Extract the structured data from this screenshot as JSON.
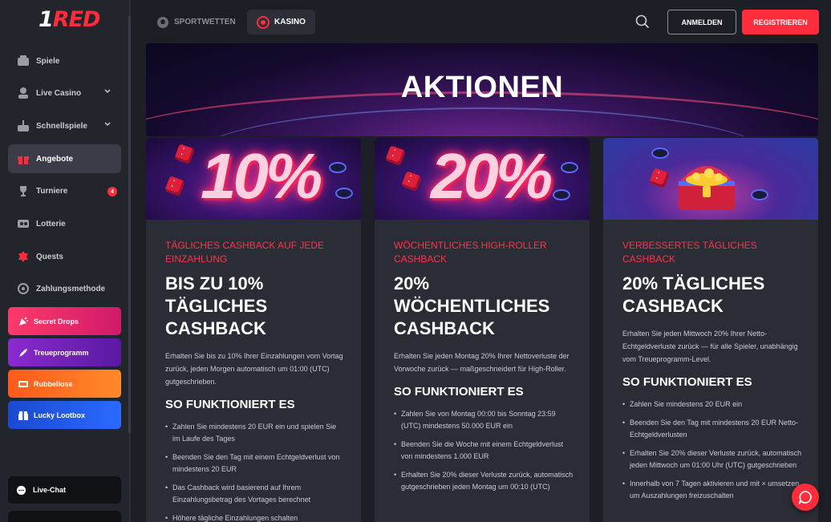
{
  "brand": {
    "logo_prefix": "1",
    "logo_suffix": "RED"
  },
  "sidebar": {
    "items": [
      {
        "label": "Spiele",
        "icon": "games-icon"
      },
      {
        "label": "Live Casino",
        "icon": "live-casino-icon"
      },
      {
        "label": "Schnellspiele",
        "icon": "quick-games-icon"
      },
      {
        "label": "Angebote",
        "icon": "gift-icon"
      },
      {
        "label": "Turniere",
        "icon": "trophy-icon",
        "badge": "4"
      },
      {
        "label": "Lotterie",
        "icon": "lottery-icon"
      },
      {
        "label": "Quests",
        "icon": "quests-icon"
      },
      {
        "label": "Zahlungsmethode",
        "icon": "payment-icon"
      }
    ],
    "promos": [
      {
        "label": "Secret Drops",
        "icon": "confetti-icon"
      },
      {
        "label": "Treueprogramm",
        "icon": "rocket-icon"
      },
      {
        "label": "Rubbellose",
        "icon": "scratch-card-icon"
      },
      {
        "label": "Lucky Lootbox",
        "icon": "lootbox-icon"
      }
    ],
    "chat_label": "Live-Chat"
  },
  "topbar": {
    "tab_sport": "SPORTWETTEN",
    "tab_kasino": "KASINO",
    "login": "ANMELDEN",
    "register": "REGISTRIEREN"
  },
  "hero": {
    "title": "AKTIONEN"
  },
  "cards": [
    {
      "image_text": "10%",
      "subtitle": "TÄGLICHES CASHBACK AUF JEDE EINZAHLUNG",
      "heading": "BIS ZU 10% TÄGLICHES CASHBACK",
      "description": "Erhalten Sie bis zu 10% Ihrer Einzahlungen vom Vortag zurück, jeden Morgen automatisch um 01:00 (UTC) gutgeschrieben.",
      "how_title": "SO FUNKTIONIERT ES",
      "steps": [
        "Zahlen Sie mindestens 20 EUR ein und spielen Sie im Laufe des Tages",
        "Beenden Sie den Tag mit einem Echtgeldverlust von mindestens 20 EUR",
        "Das Cashback wird basierend auf Ihrem Einzahlungsbetrag des Vortages berechnet",
        "Höhere tägliche Einzahlungen schalten"
      ]
    },
    {
      "image_text": "20%",
      "subtitle": "WÖCHENTLICHES HIGH-ROLLER CASHBACK",
      "heading": "20% WÖCHENTLICHES CASHBACK",
      "description": "Erhalten Sie jeden Montag 20% Ihrer Nettoverluste der Vorwoche zurück — maßgeschneidert für High-Roller.",
      "how_title": "SO FUNKTIONIERT ES",
      "steps": [
        "Zahlen Sie von Montag 00:00 bis Sonntag 23:59 (UTC) mindestens 50.000 EUR ein",
        "Beenden Sie die Woche mit einem Echtgeldverlust von mindestens 1.000 EUR",
        "Erhalten Sie 20% dieser Verluste zurück, automatisch gutgeschrieben jeden Montag um 00:10 (UTC)"
      ]
    },
    {
      "image_text": "",
      "subtitle": "VERBESSERTES TÄGLICHES CASHBACK",
      "heading": "20% TÄGLICHES CASHBACK",
      "description": "Erhalten Sie jeden Mittwoch 20% Ihrer Netto-Echtgeldverluste zurück — für alle Spieler, unabhängig vom Treueprogramm-Level.",
      "how_title": "SO FUNKTIONIERT ES",
      "steps": [
        "Zahlen Sie mindestens 20 EUR ein",
        "Beenden Sie den Tag mit mindestens 20 EUR Netto-Echtgeldverlusten",
        "Erhalten Sie 20% dieser Verluste zurück, automatisch jeden Mittwoch um 01:00 Uhr (UTC) gutgeschrieben",
        "Innerhalb von 7 Tagen aktivieren und mit × umsetzen, um Auszahlungen freizuschalten"
      ]
    }
  ],
  "colors": {
    "accent": "#ff2d3b",
    "background": "#1d1f26",
    "card": "#2b2d36",
    "sidebar": "#23252d"
  }
}
